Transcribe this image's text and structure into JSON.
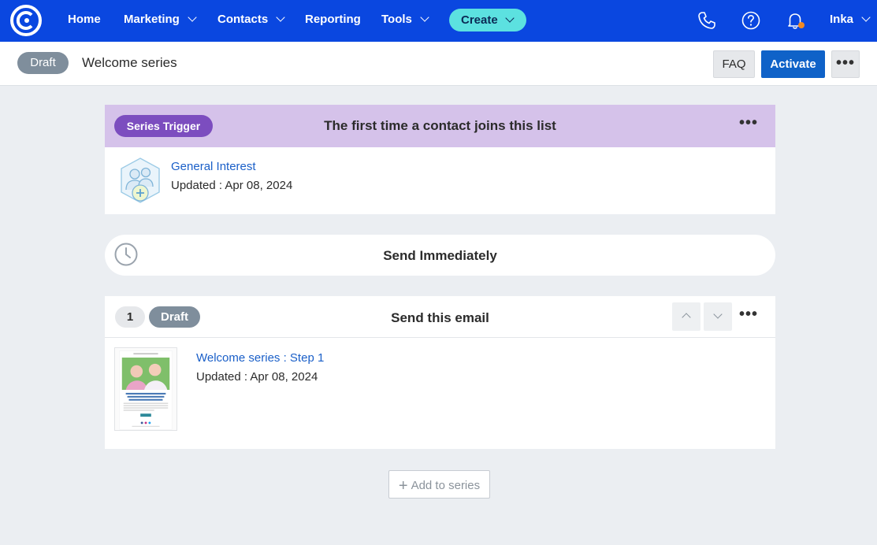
{
  "nav": {
    "items": [
      {
        "label": "Home",
        "has_dropdown": false
      },
      {
        "label": "Marketing",
        "has_dropdown": true
      },
      {
        "label": "Contacts",
        "has_dropdown": true
      },
      {
        "label": "Reporting",
        "has_dropdown": false
      },
      {
        "label": "Tools",
        "has_dropdown": true
      }
    ],
    "create_label": "Create",
    "user_name": "Inka",
    "icons": [
      "phone-icon",
      "help-icon",
      "bell-icon"
    ],
    "notification_dot_color": "#f08a24",
    "brand_color": "#0a47e0"
  },
  "header": {
    "status": "Draft",
    "title": "Welcome series",
    "faq_label": "FAQ",
    "activate_label": "Activate",
    "more_label": "•••"
  },
  "trigger": {
    "badge": "Series Trigger",
    "title": "The first time a contact joins this list",
    "more_label": "•••",
    "list_name": "General Interest",
    "updated": "Updated : Apr 08, 2024"
  },
  "timing": {
    "title": "Send Immediately"
  },
  "email_step": {
    "step_number": "1",
    "status": "Draft",
    "title": "Send this email",
    "more_label": "•••",
    "email_name": "Welcome series : Step 1",
    "updated": "Updated : Apr 08, 2024"
  },
  "add_button_label": "Add to series"
}
